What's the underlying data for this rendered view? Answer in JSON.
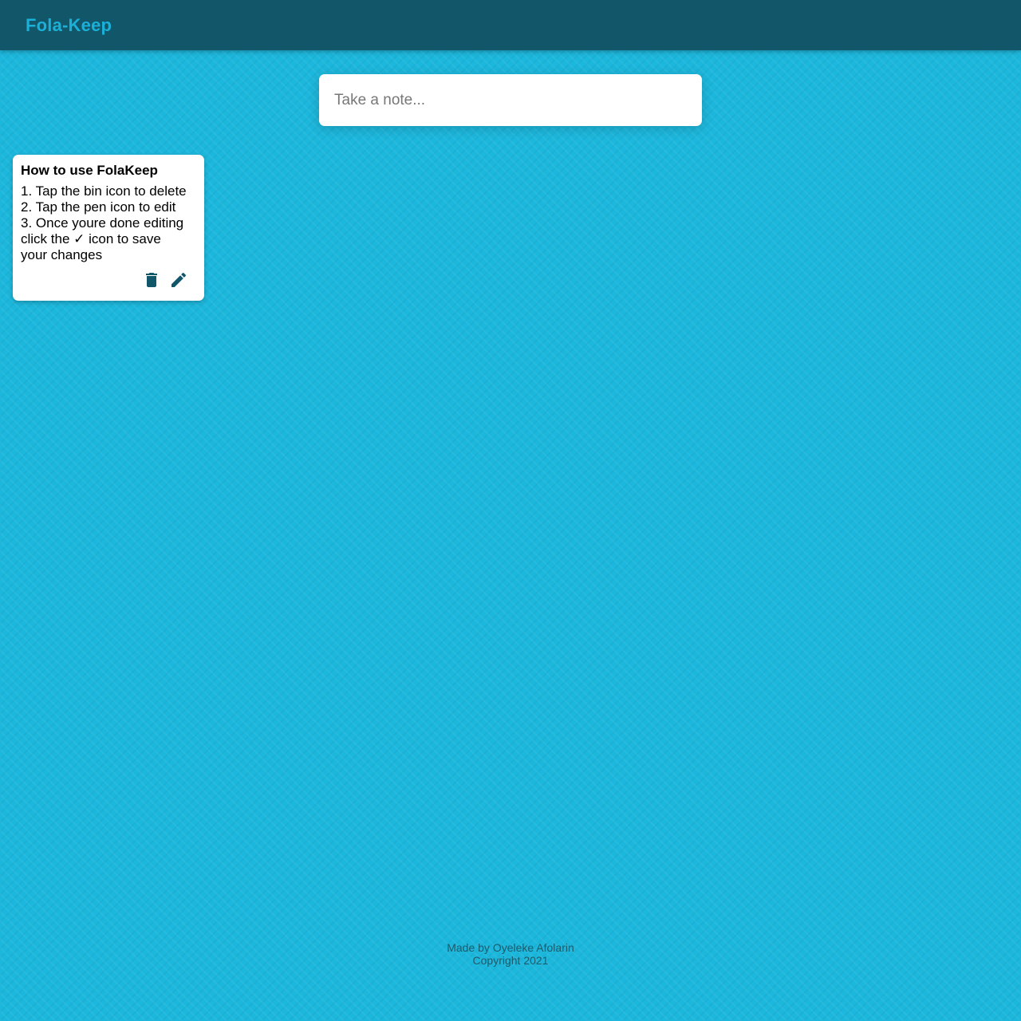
{
  "header": {
    "title": "Fola-Keep"
  },
  "create_note": {
    "placeholder": "Take a note..."
  },
  "notes": [
    {
      "title": "How to use FolaKeep",
      "lines": [
        "1. Tap the bin icon to delete",
        "2. Tap the pen icon to edit",
        "3. Once youre done editing",
        "click the ✓ icon to save",
        "your changes"
      ],
      "actions": {
        "delete_icon": "trash-icon",
        "edit_icon": "pencil-icon"
      }
    }
  ],
  "footer": {
    "credit": "Made by Oyeleke Afolarin",
    "copyright": "Copyright  2021"
  },
  "colors": {
    "header_bg": "#12566a",
    "brand_text": "#1ab0d8",
    "page_bg": "#1cb7dc",
    "icon_color": "#12566a",
    "footer_text": "#1e5a6a"
  }
}
